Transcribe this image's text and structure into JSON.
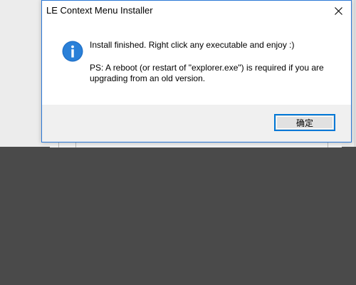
{
  "dialog": {
    "title": "LE Context Menu Installer",
    "icon": "info-icon",
    "message": "Install finished. Right click any executable and enjoy :)",
    "note": "PS: A reboot (or restart of \"explorer.exe\") is required if you are upgrading from an old version.",
    "ok_label": "确定",
    "close_icon": "close-icon"
  },
  "colors": {
    "accent": "#0078d7",
    "desktop": "#4a4a4a",
    "footer": "#f0f0f0"
  }
}
